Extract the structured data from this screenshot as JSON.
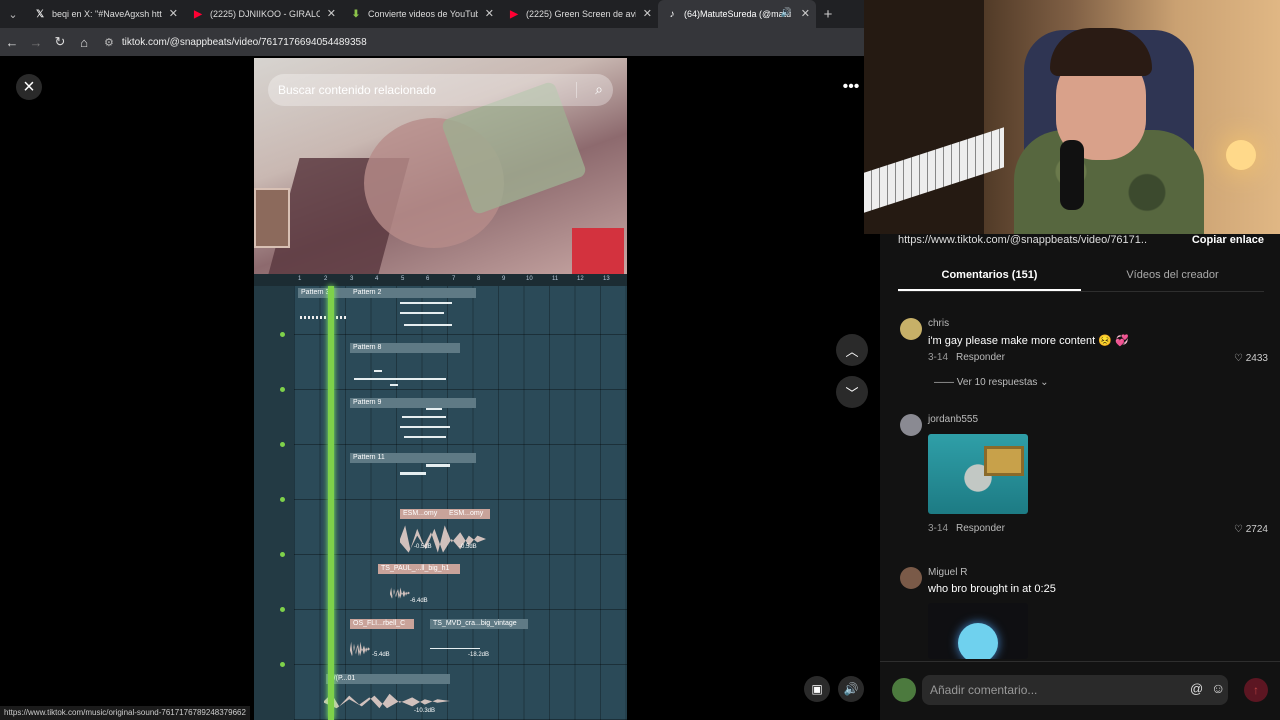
{
  "browser": {
    "tabs": [
      {
        "title": "beqi en X: \"#NaveAgxsh https:/",
        "favicon": "x-logo-icon",
        "color": "#ffffff"
      },
      {
        "title": "(2225) DJNIIKOO - GIRALO (AFRO",
        "favicon": "youtube-icon",
        "color": "#ff0033"
      },
      {
        "title": "Convierte videos de YouTube a",
        "favicon": "download-icon",
        "color": "#8bc34a"
      },
      {
        "title": "(2225) Green Screen de avion -",
        "favicon": "youtube-icon",
        "color": "#ff0033"
      },
      {
        "title": "(64)MatuteSureda (@matu",
        "favicon": "tiktok-icon",
        "color": "#ffffff"
      }
    ],
    "url": "tiktok.com/@snappbeats/video/7617176694054489358",
    "status_url": "https://www.tiktok.com/music/original-sound-7617176789248379662"
  },
  "video": {
    "search_placeholder": "Buscar contenido relacionado",
    "ruler": [
      "1",
      "2",
      "3",
      "4",
      "5",
      "6",
      "7",
      "8",
      "9",
      "10",
      "11",
      "12",
      "13"
    ],
    "clips": {
      "pattern3": "Pattern 3",
      "pattern2": "Pattern 2",
      "pattern8": "Pattern 8",
      "pattern9": "Pattern 9",
      "pattern11": "Pattern 11",
      "esm1": "ESM...omy",
      "esm2": "ESM...omy",
      "ts_paul": "TS_PAUL_...ll_big_h1",
      "os_fli": "OS_FLI...rbell_C",
      "ts_mvd": "TS_MVD_cra...big_vintage",
      "wp": "W(P...01"
    },
    "db": {
      "a": "-0.5dB",
      "b": "-0.5dB",
      "c": "-6.4dB",
      "d": "-5.4dB",
      "e": "-18.2dB",
      "f": "-10.3dB"
    }
  },
  "panel": {
    "share_link": "https://www.tiktok.com/@snappbeats/video/76171...",
    "copy_link": "Copiar enlace",
    "tabs": [
      "Comentarios (151)",
      "Vídeos del creador"
    ],
    "comments": [
      {
        "user": "chris",
        "text": "i'm gay please make more content 😣 💞",
        "date": "3-14",
        "reply": "Responder",
        "likes": "2433",
        "more": "Ver 10 respuestas"
      },
      {
        "user": "jordanb555",
        "text": "",
        "date": "3-14",
        "reply": "Responder",
        "likes": "2724"
      },
      {
        "user": "Miguel R",
        "text": "who bro brought in at 0:25",
        "date": "",
        "reply": "",
        "likes": ""
      }
    ],
    "input_placeholder": "Añadir comentario..."
  }
}
